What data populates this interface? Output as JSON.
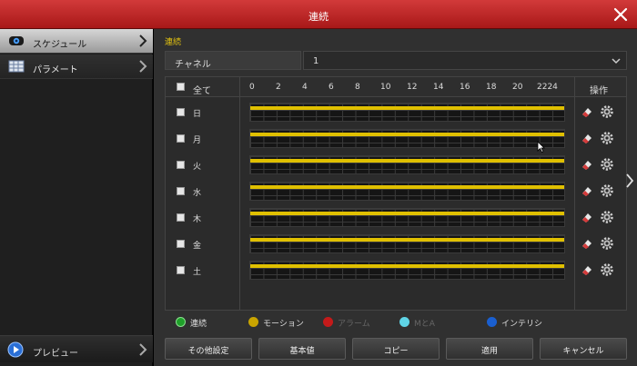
{
  "window": {
    "title": "連続"
  },
  "sidebar": {
    "items": [
      {
        "label": "スケジュール",
        "icon": "camera-icon",
        "active": true
      },
      {
        "label": "パラメート",
        "icon": "table-icon",
        "active": false
      }
    ],
    "preview": {
      "label": "プレビュー",
      "icon": "play-icon"
    }
  },
  "main": {
    "section_title": "連続",
    "channel": {
      "label": "チャネル",
      "value": "1"
    },
    "header": {
      "all_label": "全て",
      "hours": [
        "0",
        "2",
        "4",
        "6",
        "8",
        "10",
        "12",
        "14",
        "16",
        "18",
        "20",
        "2224"
      ],
      "ops_label": "操作"
    },
    "days": [
      "日",
      "月",
      "火",
      "水",
      "木",
      "金",
      "土"
    ],
    "legend": [
      {
        "label": "連続",
        "color": "#1fa02a",
        "active": true
      },
      {
        "label": "モーション",
        "color": "#c9a400",
        "active": true
      },
      {
        "label": "アラーム",
        "color": "#c41a1a",
        "active": false
      },
      {
        "label": "MとA",
        "color": "#5fd4e6",
        "active": false
      },
      {
        "label": "インテリシ",
        "color": "#1a5fd0",
        "active": true
      }
    ],
    "buttons": [
      "その他設定",
      "基本値",
      "コピー",
      "適用",
      "キャンセル"
    ]
  },
  "colors": {
    "accent": "#c42020",
    "schedule_fill": "#e0c000",
    "section_title": "#e0c010"
  }
}
